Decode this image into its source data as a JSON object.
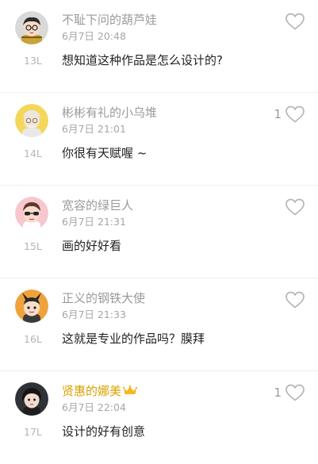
{
  "comments": [
    {
      "username": "不耻下问的葫芦娃",
      "time": "6月7日 20:48",
      "floor": "13L",
      "text": "想知道这种作品是怎么设计的?",
      "likes": "",
      "avatar_icon": "avatar-boy-glasses-icon",
      "vip": false
    },
    {
      "username": "彬彬有礼的小乌堆",
      "time": "6月7日 21:01",
      "floor": "14L",
      "text": "你很有天赋喔 ~",
      "likes": "1",
      "avatar_icon": "avatar-grandpa-icon",
      "vip": false
    },
    {
      "username": "宽容的绿巨人",
      "time": "6月7日 21:31",
      "floor": "15L",
      "text": "画的好好看",
      "likes": "",
      "avatar_icon": "avatar-sunglasses-icon",
      "vip": false
    },
    {
      "username": "正义的钢铁大使",
      "time": "6月7日 21:33",
      "floor": "16L",
      "text": "这就是专业的作品吗？膜拜",
      "likes": "",
      "avatar_icon": "avatar-horns-icon",
      "vip": false
    },
    {
      "username": "贤惠的娜美",
      "time": "6月7日 22:04",
      "floor": "17L",
      "text": "设计的好有创意",
      "likes": "1",
      "avatar_icon": "avatar-dark-hair-icon",
      "vip": true
    }
  ],
  "colors": {
    "username": "#9a9a9a",
    "vip_username": "#d9a100",
    "crown": "#f5b81c",
    "heart_outline": "#b5b5b5"
  }
}
